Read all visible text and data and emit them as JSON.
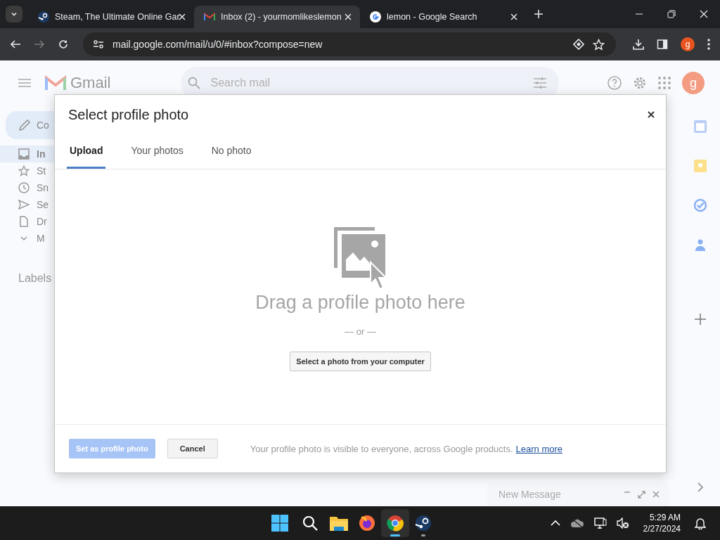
{
  "browser": {
    "tabs": [
      {
        "title": "Steam, The Ultimate Online Gar",
        "selected": false
      },
      {
        "title": "Inbox (2) - yourmomlikeslemon",
        "selected": true
      },
      {
        "title": "lemon - Google Search",
        "selected": false
      }
    ],
    "address": "mail.google.com/mail/u/0/#inbox?compose=new",
    "avatar": "g"
  },
  "gmail": {
    "logo_text": "Gmail",
    "search": {
      "placeholder": "Search mail"
    },
    "avatar": "g",
    "compose_label": "Co",
    "nav": [
      {
        "label": "In",
        "selected": true
      },
      {
        "label": "St",
        "selected": false
      },
      {
        "label": "Sn",
        "selected": false
      },
      {
        "label": "Se",
        "selected": false
      },
      {
        "label": "Dr",
        "selected": false
      },
      {
        "label": "M",
        "selected": false
      }
    ],
    "labels_heading": "Labels",
    "compose_window": {
      "title": "New Message"
    }
  },
  "dialog": {
    "title": "Select profile photo",
    "tabs": [
      {
        "label": "Upload",
        "selected": true
      },
      {
        "label": "Your photos",
        "selected": false
      },
      {
        "label": "No photo",
        "selected": false
      }
    ],
    "drop_text": "Drag a profile photo here",
    "or_text": "— or —",
    "select_button": "Select a photo from your computer",
    "footer": {
      "primary": {
        "label": "Set as profile photo",
        "disabled": true
      },
      "cancel": "Cancel",
      "note": "Your profile photo is visible to everyone, across Google products.",
      "link": "Learn more"
    }
  },
  "taskbar": {
    "apps": [
      {
        "running": false,
        "active": false
      },
      {
        "running": false,
        "active": false
      },
      {
        "running": true,
        "active": true
      },
      {
        "running": true,
        "active": false
      }
    ],
    "time": "5:29 AM",
    "date": "2/27/2024"
  }
}
